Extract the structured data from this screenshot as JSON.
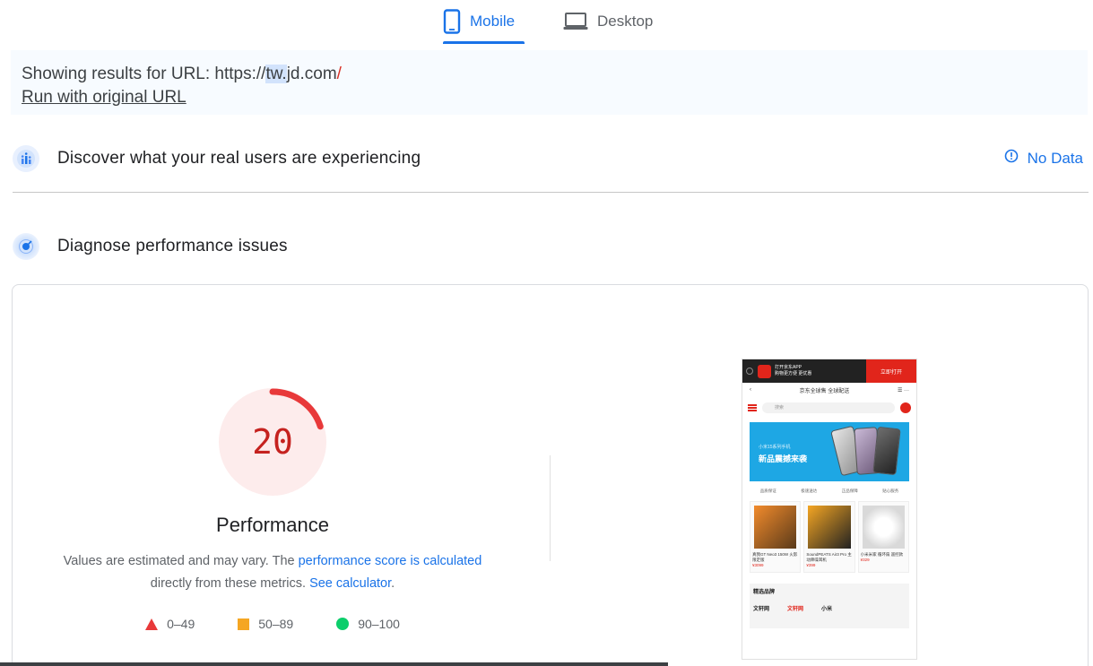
{
  "tabs": {
    "mobile": "Mobile",
    "desktop": "Desktop"
  },
  "url_banner": {
    "prefix": "Showing results for URL: https://",
    "highlight": "tw.",
    "domain": "jd.com",
    "slash": "/",
    "run_link": "Run with original URL"
  },
  "crux": {
    "title": "Discover what your real users are experiencing",
    "status": "No Data"
  },
  "diagnose": {
    "title": "Diagnose performance issues"
  },
  "performance": {
    "score": "20",
    "score_fraction": 0.2,
    "title": "Performance",
    "desc_1": "Values are estimated and may vary. The ",
    "desc_link_1": "performance score is calculated",
    "desc_2": "directly from these metrics. ",
    "desc_link_2": "See calculator",
    "desc_3": "."
  },
  "legend": {
    "fail": "0–49",
    "average": "50–89",
    "pass": "90–100"
  },
  "colors": {
    "accent": "#1a73e8",
    "fail": "#e8393a",
    "average": "#f5a623",
    "pass": "#0cce6b"
  },
  "thumbnail": {
    "app_bar_text_1": "打开京东APP",
    "app_bar_text_2": "购物更方便 更优惠",
    "open_button": "立即打开",
    "nav_title": "京东全球售 全球配送",
    "search_placeholder": "搜索",
    "banner_small": "小米15系列手机",
    "banner_title": "新品震撼来袭",
    "features": [
      "品质保证",
      "极速送达",
      "正品保障",
      "贴心服务"
    ],
    "products": [
      {
        "name": "真我GT Neo3 150W 火影限定版",
        "price": "¥3099"
      },
      {
        "name": "SoundPEATS Air3 Pro 主动降噪耳机",
        "price": "¥399"
      },
      {
        "name": "小米米家 循环扇 遥控款",
        "price": "¥329"
      }
    ],
    "brands_title": "精选品牌",
    "brand_1": "文轩网",
    "brand_2": "文轩网",
    "brand_3": "小米"
  }
}
